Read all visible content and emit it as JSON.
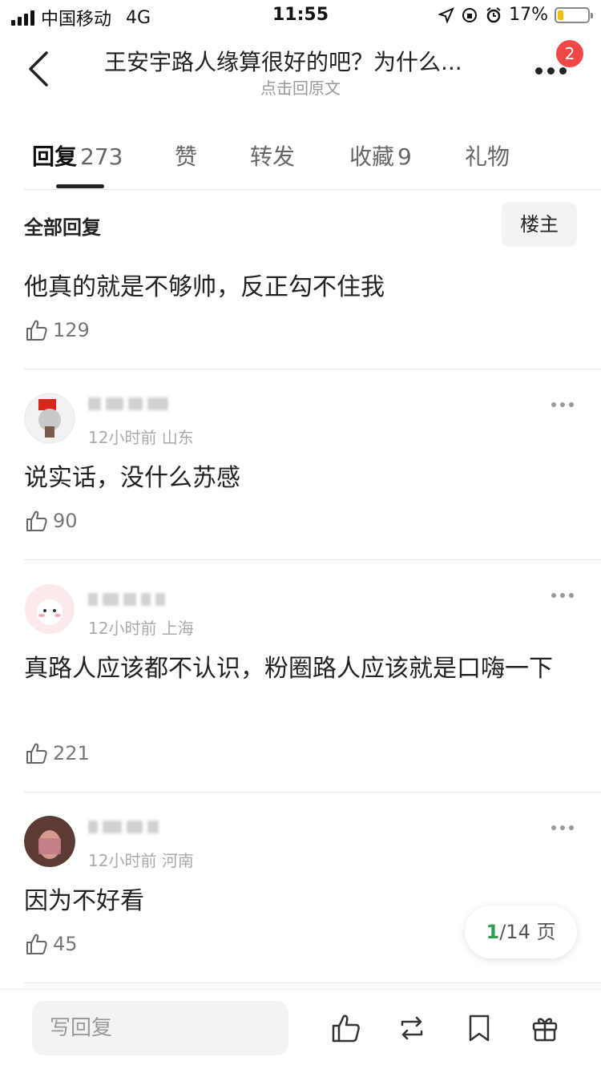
{
  "status_bar": {
    "carrier": "中国移动",
    "network": "4G",
    "time": "11:55",
    "battery": "17%",
    "battery_level": 0.17
  },
  "header": {
    "title": "王安宇路人缘算很好的吧？为什么...",
    "subtitle": "点击回原文",
    "badge_count": "2"
  },
  "tabs": [
    {
      "label": "回复",
      "count": "273"
    },
    {
      "label": "赞",
      "count": ""
    },
    {
      "label": "转发",
      "count": ""
    },
    {
      "label": "收藏",
      "count": "9"
    },
    {
      "label": "礼物",
      "count": ""
    }
  ],
  "filter": {
    "title": "全部回复",
    "owner_button": "楼主"
  },
  "comments": [
    {
      "meta": "",
      "text": "他真的就是不够帅，反正勾不住我",
      "likes": "129"
    },
    {
      "meta": "12小时前 山东",
      "text": "说实话，没什么苏感",
      "likes": "90"
    },
    {
      "meta": "12小时前 上海",
      "text": "真路人应该都不认识，粉圈路人应该就是口嗨一下",
      "likes": "221"
    },
    {
      "meta": "12小时前 河南",
      "text": "因为不好看",
      "likes": "45"
    }
  ],
  "pagination": {
    "current": "1",
    "total": "/14 页"
  },
  "bottom_bar": {
    "reply_placeholder": "写回复"
  },
  "colors": {
    "accent_green": "#2e9e4f",
    "badge_red": "#f04747"
  }
}
